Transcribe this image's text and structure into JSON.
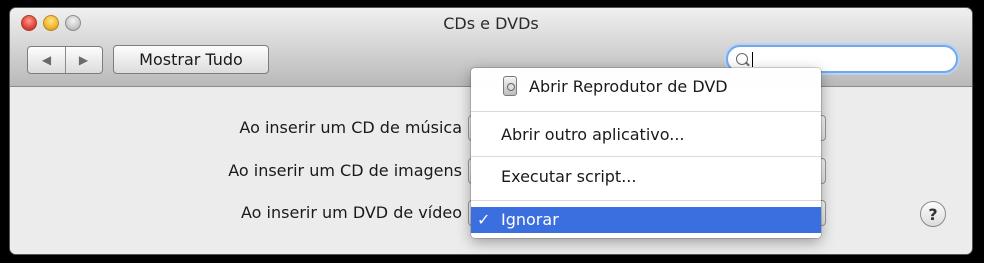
{
  "window": {
    "title": "CDs e DVDs"
  },
  "toolbar": {
    "back_label": "◀",
    "forward_label": "▶",
    "show_all_label": "Mostrar Tudo",
    "search_value": "",
    "search_placeholder": ""
  },
  "settings": {
    "rows": [
      {
        "label": "Ao inserir um CD de música"
      },
      {
        "label": "Ao inserir um CD de imagens"
      },
      {
        "label": "Ao inserir um DVD de vídeo"
      }
    ],
    "help_label": "?"
  },
  "popup_menu": {
    "items": [
      {
        "label": "Abrir Reprodutor de DVD",
        "icon": "dvd-player-icon"
      },
      {
        "label": "Abrir outro aplicativo..."
      },
      {
        "label": "Executar script..."
      },
      {
        "label": "Ignorar",
        "checked": true,
        "check_glyph": "✓"
      }
    ]
  },
  "colors": {
    "selection": "#3b6fe0",
    "search_focus": "#74a9e8"
  }
}
